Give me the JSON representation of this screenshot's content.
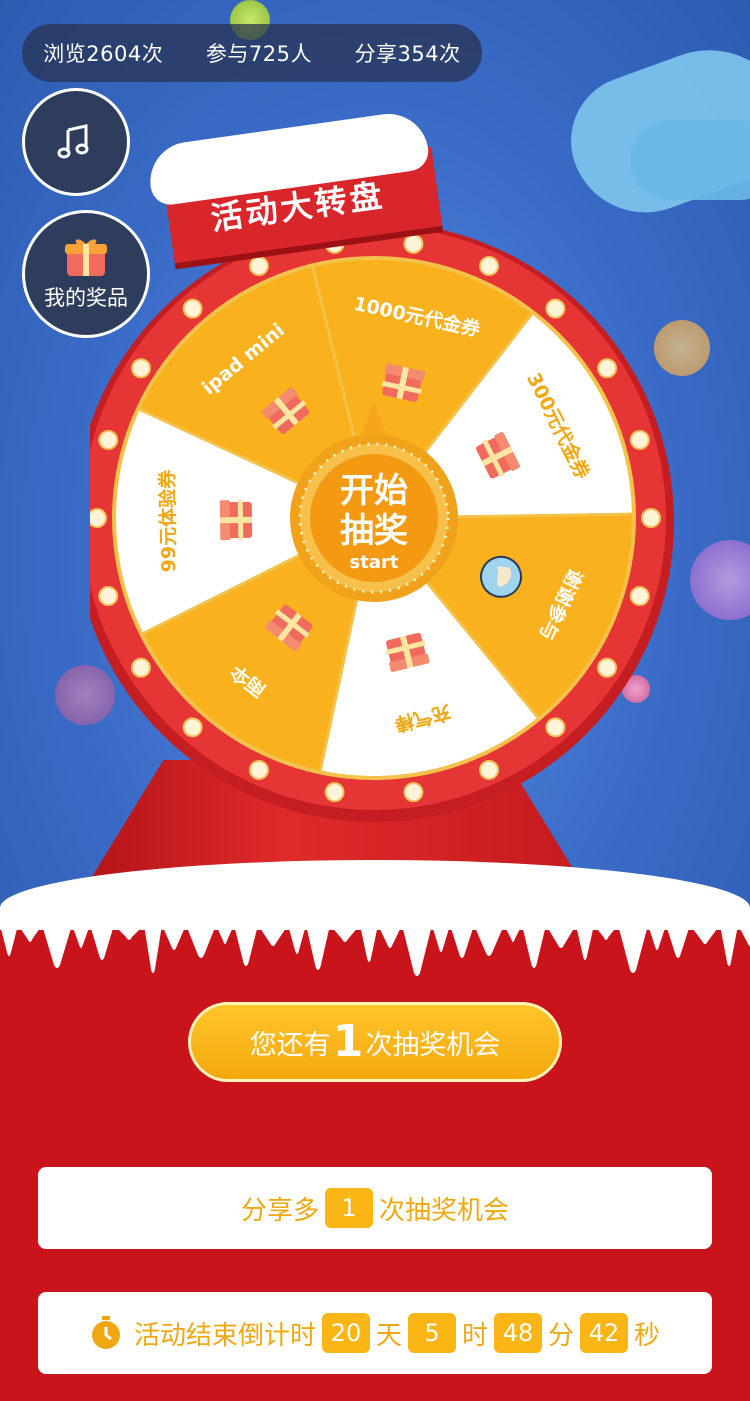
{
  "stats": {
    "views": "浏览2604次",
    "participants": "参与725人",
    "shares": "分享354次"
  },
  "side_buttons": {
    "music_icon": "music-icon",
    "prize_label": "我的奖品",
    "prize_icon": "gift-icon"
  },
  "wheel": {
    "title": "活动大转盘",
    "center_line1": "开始",
    "center_line2": "抽奖",
    "center_line3": "start",
    "prizes": [
      "1000元代金券",
      "300元代金券",
      "谢谢参与",
      "充气棒",
      "雨伞",
      "99元体验券",
      "ipad mini"
    ]
  },
  "chance": {
    "prefix": "您还有",
    "count": "1",
    "suffix": "次抽奖机会"
  },
  "share": {
    "prefix": "分享多",
    "count": "1",
    "suffix": "次抽奖机会"
  },
  "countdown": {
    "label": "活动结束倒计时",
    "days": "20",
    "days_unit": "天",
    "hours": "5",
    "hours_unit": "时",
    "minutes": "48",
    "minutes_unit": "分",
    "seconds": "42",
    "seconds_unit": "秒"
  },
  "colors": {
    "wheel_rim": "#e53534",
    "slice_yellow": "#f9b21d",
    "slice_white": "#ffffff",
    "page_red": "#c8141a",
    "accent_yellow": "#fbb514"
  }
}
